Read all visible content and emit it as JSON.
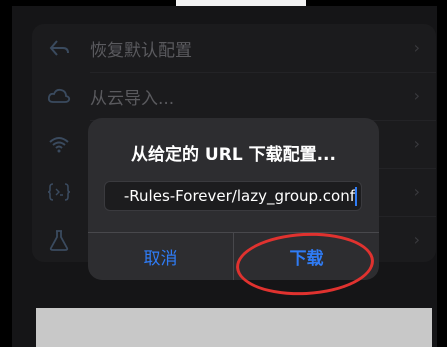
{
  "settings_list": {
    "items": [
      {
        "label": "恢复默认配置",
        "icon": "undo-arrow-icon"
      },
      {
        "label": "从云导入...",
        "icon": "cloud-icon"
      },
      {
        "label": "",
        "icon": "wifi-icon"
      },
      {
        "label": "",
        "icon": "code-braces-icon"
      },
      {
        "label": "",
        "icon": "flask-icon"
      }
    ],
    "chevron": "›"
  },
  "alert": {
    "title": "从给定的 URL 下载配置...",
    "input_value": "-Rules-Forever/lazy_group.conf",
    "cancel_label": "取消",
    "download_label": "下载"
  },
  "colors": {
    "accent": "#2f7cf6",
    "annotation_ring": "#e0322f"
  }
}
